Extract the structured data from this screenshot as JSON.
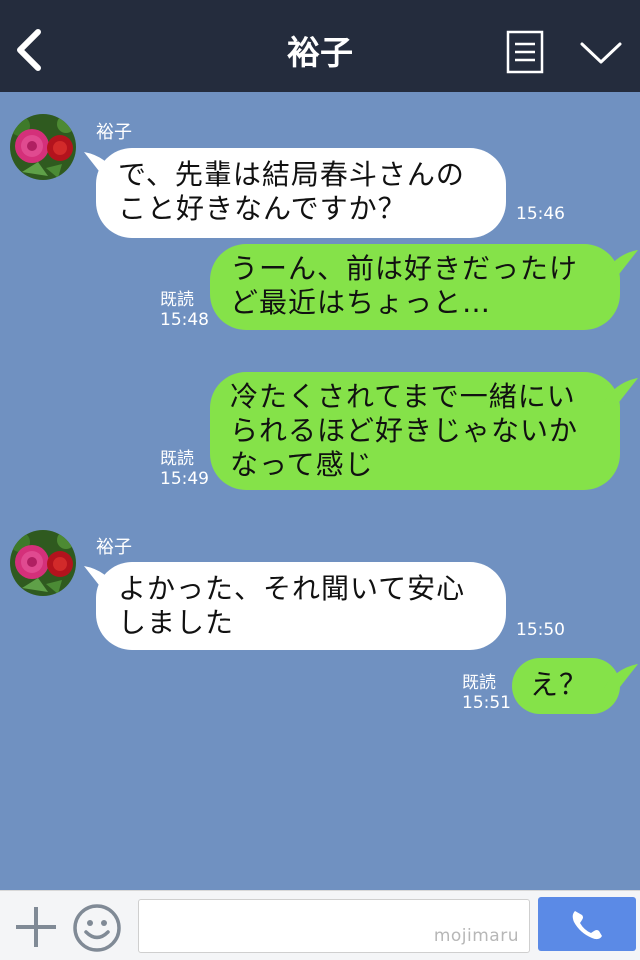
{
  "header": {
    "title": "裕子",
    "back_icon": "chevron-left-icon",
    "menu_icon": "document-list-icon",
    "more_icon": "chevron-down-icon",
    "background": "#242c3d"
  },
  "chat": {
    "background": "#7091c1",
    "messages": [
      {
        "sender": "裕子",
        "direction": "incoming",
        "lines": [
          "で、先輩は結局春斗さんの",
          "こと好きなんですか？"
        ],
        "time": "15:46"
      },
      {
        "direction": "outgoing",
        "read": "既読",
        "lines": [
          "うーん、前は好きだったけ",
          "ど最近はちょっと…"
        ],
        "time": "15:48"
      },
      {
        "direction": "outgoing",
        "read": "既読",
        "lines": [
          "冷たくされてまで一緒にい",
          "られるほど好きじゃないか",
          "なって感じ"
        ],
        "time": "15:49"
      },
      {
        "sender": "裕子",
        "direction": "incoming",
        "lines": [
          "よかった、それ聞いて安心",
          "しました"
        ],
        "time": "15:50"
      },
      {
        "direction": "outgoing",
        "read": "既読",
        "lines": [
          "え？"
        ],
        "time": "15:51"
      }
    ]
  },
  "input_bar": {
    "plus_icon": "plus-icon",
    "emoji_icon": "smiley-icon",
    "watermark": "mojimaru",
    "call_icon": "phone-icon",
    "call_color": "#5b8ae6"
  },
  "colors": {
    "outgoing_bubble": "#85e249",
    "incoming_bubble": "#ffffff"
  }
}
